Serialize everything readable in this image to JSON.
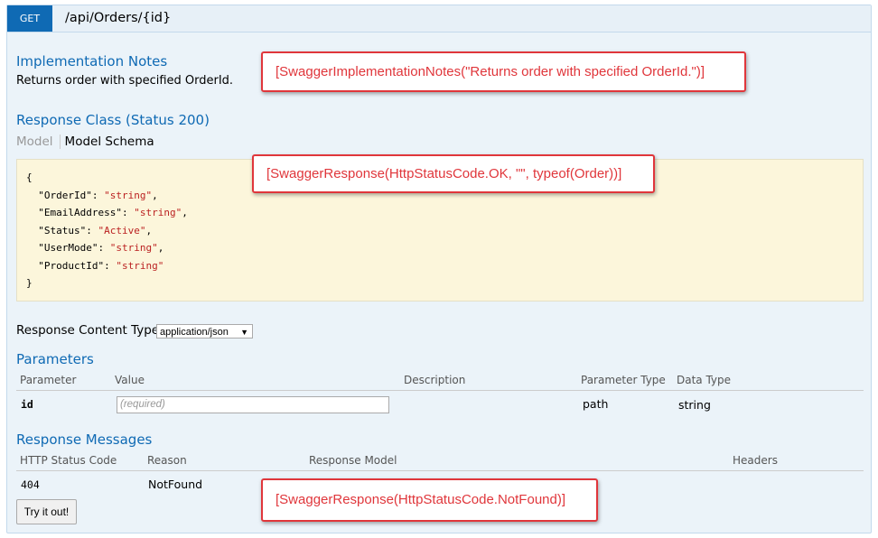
{
  "endpoint": {
    "method": "GET",
    "path": "/api/Orders/{id}"
  },
  "implementation_notes": {
    "heading": "Implementation Notes",
    "text": "Returns order with specified OrderId.",
    "callout": "[SwaggerImplementationNotes(\"Returns order with specified OrderId.\")]"
  },
  "response_class": {
    "heading": "Response Class (Status 200)",
    "tabs": [
      "Model",
      "Model Schema"
    ],
    "callout": "[SwaggerResponse(HttpStatusCode.OK, \"\", typeof(Order))]",
    "schema_lines": [
      "{",
      "  \"OrderId\": \"string\",",
      "  \"EmailAddress\": \"string\",",
      "  \"Status\": \"Active\",",
      "  \"UserMode\": \"string\",",
      "  \"ProductId\": \"string\"",
      "}"
    ]
  },
  "content_type": {
    "label": "Response Content Type",
    "selected": "application/json"
  },
  "parameters": {
    "heading": "Parameters",
    "columns": [
      "Parameter",
      "Value",
      "Description",
      "Parameter Type",
      "Data Type"
    ],
    "row": {
      "name": "id",
      "placeholder": "(required)",
      "description": "",
      "param_type": "path",
      "data_type": "string"
    }
  },
  "response_messages": {
    "heading": "Response Messages",
    "columns": [
      "HTTP Status Code",
      "Reason",
      "Response Model",
      "Headers"
    ],
    "row": {
      "code": "404",
      "reason": "NotFound"
    },
    "callout": "[SwaggerResponse(HttpStatusCode.NotFound)]"
  },
  "try_button": "Try it out!"
}
